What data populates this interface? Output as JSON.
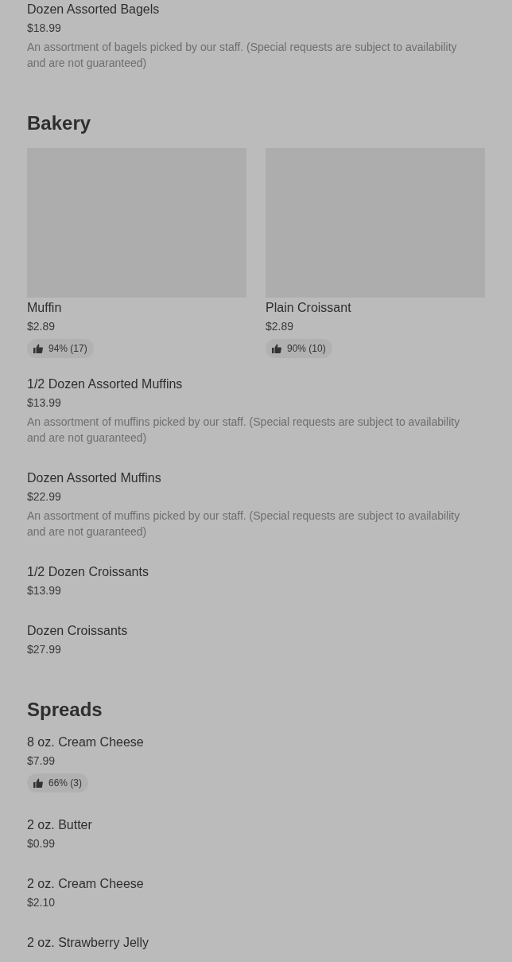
{
  "sections": [
    {
      "items": [
        {
          "kind": "row",
          "name": "Dozen Assorted Bagels",
          "price": "$18.99",
          "description": "An assortment of bagels picked by our staff. (Special requests are subject to availability and are not guaranteed)"
        }
      ]
    },
    {
      "title": "Bakery",
      "items": [
        {
          "kind": "card",
          "name": "Muffin",
          "price": "$2.89",
          "rating": "94% (17)"
        },
        {
          "kind": "card",
          "name": "Plain Croissant",
          "price": "$2.89",
          "rating": "90% (10)"
        },
        {
          "kind": "row",
          "name": "1/2 Dozen Assorted Muffins",
          "price": "$13.99",
          "description": "An assortment of muffins picked by our staff. (Special requests are subject to availability and are not guaranteed)"
        },
        {
          "kind": "row",
          "name": "Dozen Assorted Muffins",
          "price": "$22.99",
          "description": "An assortment of muffins picked by our staff. (Special requests are subject to availability and are not guaranteed)"
        },
        {
          "kind": "row",
          "name": "1/2 Dozen Croissants",
          "price": "$13.99"
        },
        {
          "kind": "row",
          "name": "Dozen Croissants",
          "price": "$27.99"
        }
      ]
    },
    {
      "title": "Spreads",
      "items": [
        {
          "kind": "row",
          "name": "8 oz. Cream Cheese",
          "price": "$7.99",
          "rating": "66% (3)"
        },
        {
          "kind": "row",
          "name": "2 oz. Butter",
          "price": "$0.99"
        },
        {
          "kind": "row",
          "name": "2 oz. Cream Cheese",
          "price": "$2.10"
        },
        {
          "kind": "row",
          "name": "2 oz. Strawberry Jelly"
        }
      ]
    }
  ]
}
